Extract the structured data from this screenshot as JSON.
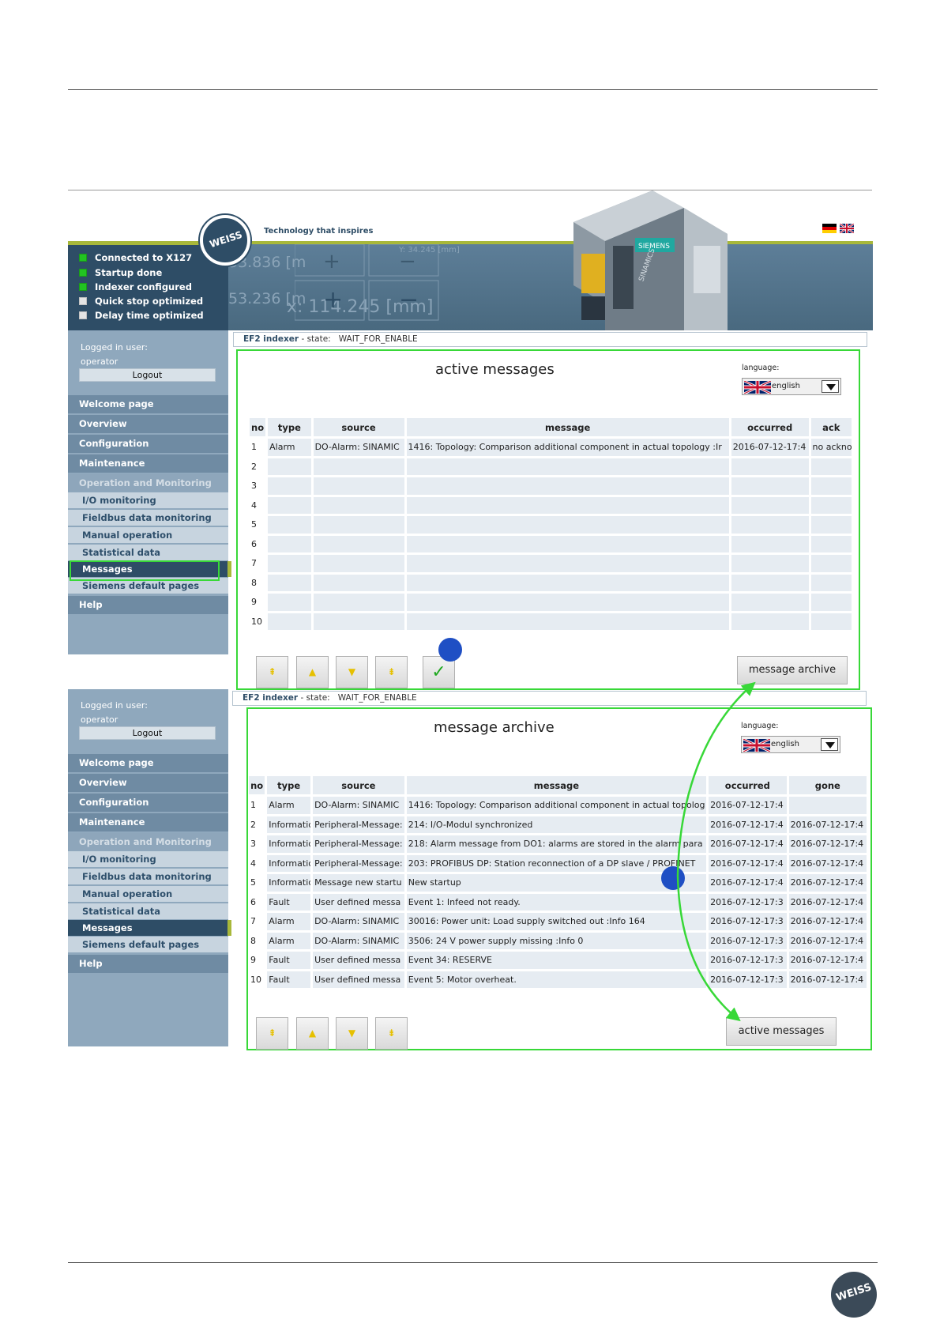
{
  "header": {
    "tagline": "Technology that inspires",
    "logo_text": "WEISS",
    "status": [
      {
        "label": "Connected to X127",
        "on": true
      },
      {
        "label": "Startup done",
        "on": true
      },
      {
        "label": "Indexer configured",
        "on": true
      },
      {
        "label": "Quick stop optimized",
        "on": false
      },
      {
        "label": "Delay time optimized",
        "on": false
      }
    ],
    "ghost_values": [
      "53.836 [m",
      "53.236 [m",
      "x: 114.245 [mm]",
      "Y: 34.245 [mm]"
    ],
    "device_brand": "SIEMENS",
    "device_name": "SINAMICS"
  },
  "sidebar_top": {
    "logged_in_label": "Logged in user:",
    "user": "operator",
    "logout": "Logout",
    "nav": {
      "welcome": "Welcome page",
      "overview": "Overview",
      "configuration": "Configuration",
      "maintenance": "Maintenance",
      "operation": "Operation and Monitoring",
      "io": "I/O monitoring",
      "fieldbus": "Fieldbus data monitoring",
      "manual": "Manual operation",
      "statistical": "Statistical data",
      "messages": "Messages",
      "siemens": "Siemens default pages",
      "help": "Help"
    }
  },
  "sidebar_bottom": {
    "logged_in_label": "Logged in user:",
    "user": "operator",
    "logout": "Logout",
    "nav": {
      "welcome": "Welcome page",
      "overview": "Overview",
      "configuration": "Configuration",
      "maintenance": "Maintenance",
      "operation": "Operation and Monitoring",
      "io": "I/O monitoring",
      "fieldbus": "Fieldbus data monitoring",
      "manual": "Manual operation",
      "statistical": "Statistical data",
      "messages": "Messages",
      "siemens": "Siemens default pages",
      "help": "Help"
    }
  },
  "state_top": {
    "device": "EF2 indexer",
    "label": "- state:",
    "value": "WAIT_FOR_ENABLE"
  },
  "state_bottom": {
    "device": "EF2 indexer",
    "label": "- state:",
    "value": "WAIT_FOR_ENABLE"
  },
  "active": {
    "title": "active messages",
    "language_label": "language:",
    "language": "english",
    "columns": [
      "no",
      "type",
      "source",
      "message",
      "occurred",
      "ack"
    ],
    "rows": [
      [
        "1",
        "Alarm",
        "DO-Alarm: SINAMIC",
        "1416: Topology: Comparison additional component in actual topology :Ir",
        "2016-07-12-17:4",
        "no ackno"
      ],
      [
        "2",
        "",
        "",
        "",
        "",
        ""
      ],
      [
        "3",
        "",
        "",
        "",
        "",
        ""
      ],
      [
        "4",
        "",
        "",
        "",
        "",
        ""
      ],
      [
        "5",
        "",
        "",
        "",
        "",
        ""
      ],
      [
        "6",
        "",
        "",
        "",
        "",
        ""
      ],
      [
        "7",
        "",
        "",
        "",
        "",
        ""
      ],
      [
        "8",
        "",
        "",
        "",
        "",
        ""
      ],
      [
        "9",
        "",
        "",
        "",
        "",
        ""
      ],
      [
        "10",
        "",
        "",
        "",
        "",
        ""
      ]
    ],
    "nav_buttons": [
      "first",
      "previous",
      "next",
      "last"
    ],
    "ack_symbol": "✓",
    "switch_button": "message archive"
  },
  "archive": {
    "title": "message archive",
    "language_label": "language:",
    "language": "english",
    "columns": [
      "no",
      "type",
      "source",
      "message",
      "occurred",
      "gone"
    ],
    "rows": [
      [
        "1",
        "Alarm",
        "DO-Alarm: SINAMIC",
        "1416: Topology: Comparison additional component in actual topolog",
        "2016-07-12-17:4",
        ""
      ],
      [
        "2",
        "Informatic",
        "Peripheral-Message:",
        "214: I/O-Modul synchronized",
        "2016-07-12-17:4",
        "2016-07-12-17:4"
      ],
      [
        "3",
        "Informatic",
        "Peripheral-Message:",
        "218: Alarm message from DO1: alarms are stored in the alarm para",
        "2016-07-12-17:4",
        "2016-07-12-17:4"
      ],
      [
        "4",
        "Informatic",
        "Peripheral-Message:",
        "203: PROFIBUS DP: Station reconnection of a DP slave / PROFINET",
        "2016-07-12-17:4",
        "2016-07-12-17:4"
      ],
      [
        "5",
        "Informatic",
        "Message new startu",
        "New startup",
        "2016-07-12-17:4",
        "2016-07-12-17:4"
      ],
      [
        "6",
        "Fault",
        "User defined messa",
        "Event 1: Infeed not ready.",
        "2016-07-12-17:3",
        "2016-07-12-17:4"
      ],
      [
        "7",
        "Alarm",
        "DO-Alarm: SINAMIC",
        "30016: Power unit: Load supply switched out :Info 164",
        "2016-07-12-17:3",
        "2016-07-12-17:4"
      ],
      [
        "8",
        "Alarm",
        "DO-Alarm: SINAMIC",
        "3506: 24 V power supply missing :Info 0",
        "2016-07-12-17:3",
        "2016-07-12-17:4"
      ],
      [
        "9",
        "Fault",
        "User defined messa",
        "Event 34: RESERVE",
        "2016-07-12-17:3",
        "2016-07-12-17:4"
      ],
      [
        "10",
        "Fault",
        "User defined messa",
        "Event 5: Motor overheat.",
        "2016-07-12-17:3",
        "2016-07-12-17:4"
      ]
    ],
    "nav_buttons": [
      "first",
      "previous",
      "next",
      "last"
    ],
    "switch_button": "active messages"
  },
  "footer": {
    "logo_text": "WEISS"
  },
  "colors": {
    "highlight": "#38d838",
    "marker": "#1f4fc4",
    "nav_dark": "#2e4d66",
    "accent_olive": "#a8b83a"
  }
}
